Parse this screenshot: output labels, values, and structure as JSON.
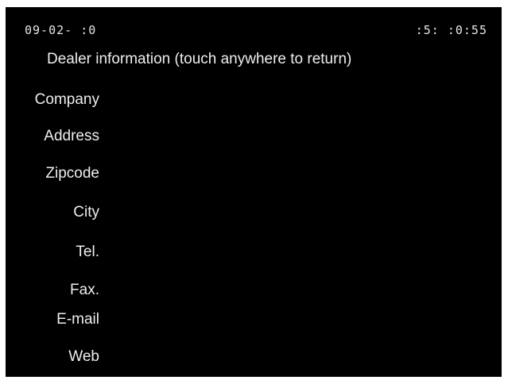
{
  "status_bar": {
    "date": "09-02-  :0",
    "time": ":5:  :0:55"
  },
  "heading": "Dealer information (touch anywhere to return)",
  "fields": [
    {
      "label": "Company"
    },
    {
      "label": "Address"
    },
    {
      "label": "Zipcode"
    },
    {
      "label": "City"
    },
    {
      "label": "Tel."
    },
    {
      "label": "Fax."
    },
    {
      "label": "E-mail"
    },
    {
      "label": "Web"
    }
  ]
}
